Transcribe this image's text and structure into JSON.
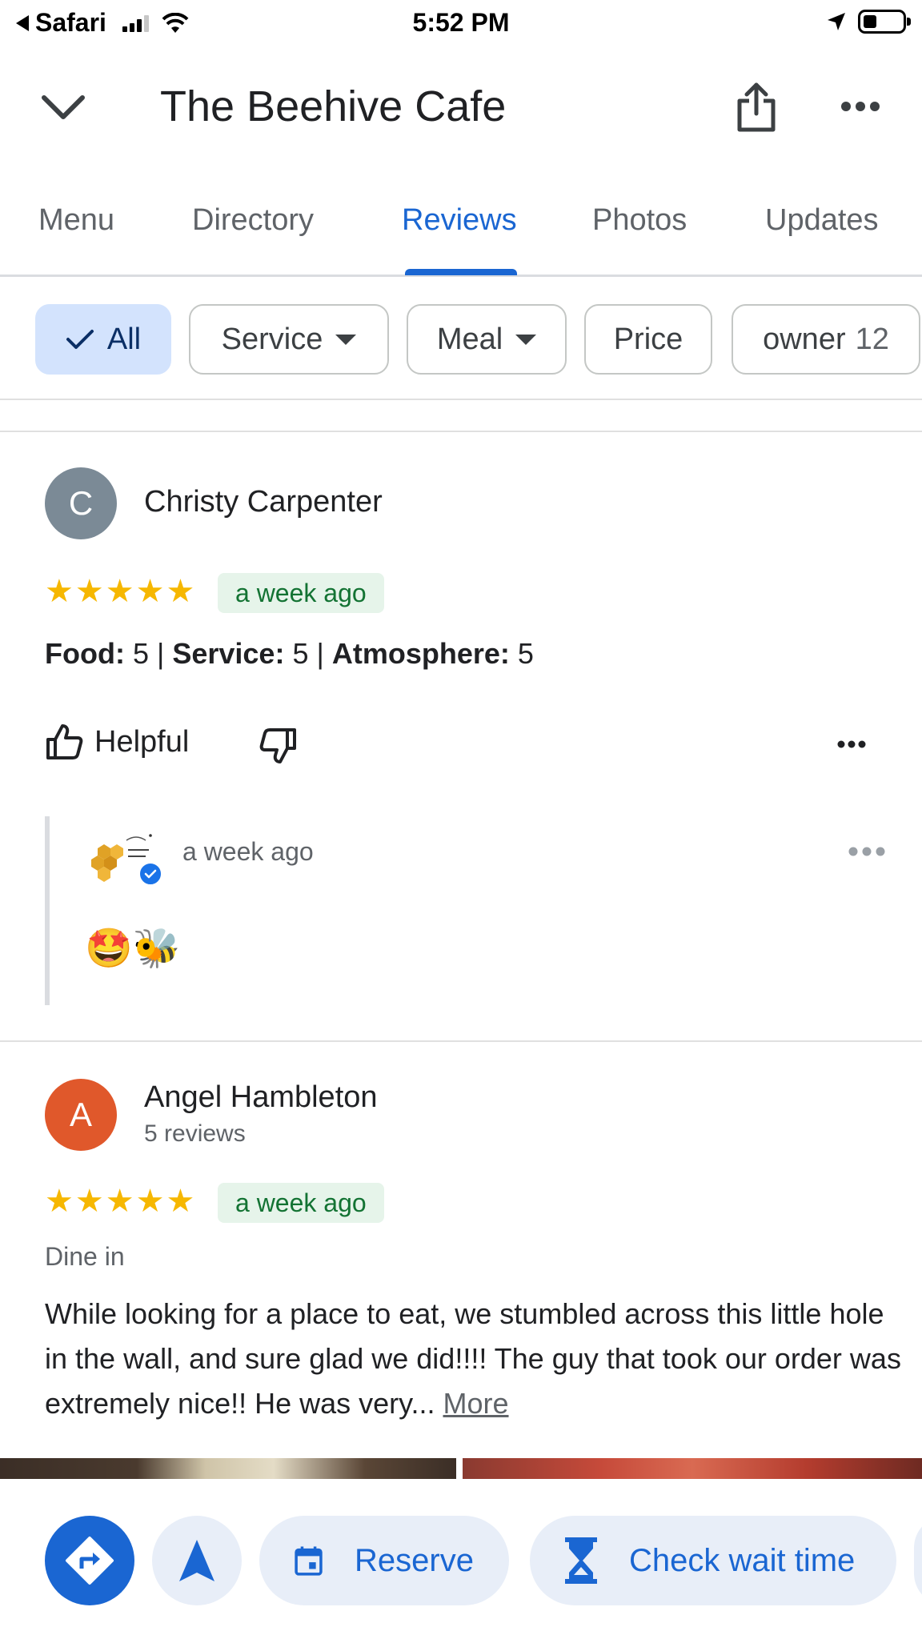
{
  "status_bar": {
    "back_app": "Safari",
    "time": "5:52 PM"
  },
  "header": {
    "title": "The Beehive Cafe"
  },
  "tabs": [
    {
      "label": "Menu",
      "active": false
    },
    {
      "label": "Directory",
      "active": false
    },
    {
      "label": "Reviews",
      "active": true
    },
    {
      "label": "Photos",
      "active": false
    },
    {
      "label": "Updates",
      "active": false
    }
  ],
  "filters": {
    "all": "All",
    "service": "Service",
    "meal": "Meal",
    "price": "Price",
    "owner": "owner",
    "owner_count": "12"
  },
  "reviews": [
    {
      "initial": "C",
      "avatar_color": "#7b8a96",
      "name": "Christy Carpenter",
      "stars": "★★★★★",
      "rating": 5,
      "time": "a week ago",
      "ratings_parts": {
        "food_label": "Food:",
        "food_value": " 5 | ",
        "service_label": "Service:",
        "service_value": " 5 | ",
        "atmosphere_label": "Atmosphere:",
        "atmosphere_value": " 5"
      },
      "helpful_label": "Helpful",
      "owner_reply": {
        "logo_text": "The Beehive Cafe",
        "time": "a week ago",
        "emojis": "🤩🐝"
      }
    },
    {
      "initial": "A",
      "avatar_color": "#e0582b",
      "name": "Angel Hambleton",
      "subtext": "5 reviews",
      "stars": "★★★★★",
      "rating": 5,
      "time": "a week ago",
      "tag": "Dine in",
      "text": "While looking for a place to eat, we stumbled across this little hole in the wall, and sure glad we did!!!! The guy that took our order was extremely nice!! He was very... ",
      "more_label": "More"
    }
  ],
  "actions": {
    "reserve": "Reserve",
    "wait_time": "Check wait time"
  },
  "colors": {
    "accent": "#1a66d2",
    "star": "#f6b700",
    "badge_bg": "#e6f4ea",
    "badge_text": "#137333"
  }
}
